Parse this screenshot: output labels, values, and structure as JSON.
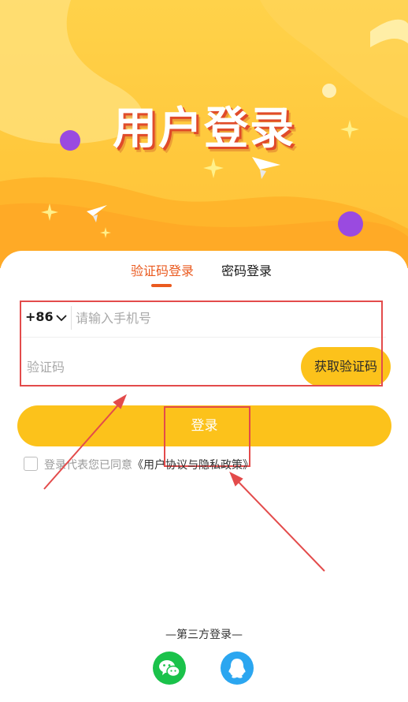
{
  "header": {
    "title": "用户登录"
  },
  "tabs": [
    {
      "label": "验证码登录",
      "active": true
    },
    {
      "label": "密码登录",
      "active": false
    }
  ],
  "phone": {
    "country_code": "+86",
    "placeholder": "请输入手机号"
  },
  "code": {
    "placeholder": "验证码",
    "get_code_label": "获取验证码"
  },
  "login": {
    "label": "登录"
  },
  "agreement": {
    "prefix": "登录代表您已同意",
    "link": "《用户协议与隐私政策》",
    "checked": false
  },
  "third_party": {
    "title": "—第三方登录—",
    "providers": [
      {
        "icon": "wechat-icon"
      },
      {
        "icon": "qq-icon"
      }
    ]
  },
  "colors": {
    "accent": "#ea5a1f",
    "button": "#fcc21b",
    "annotation": "#e34b4b",
    "wechat": "#1ac24a",
    "qq": "#2ba6f0"
  }
}
